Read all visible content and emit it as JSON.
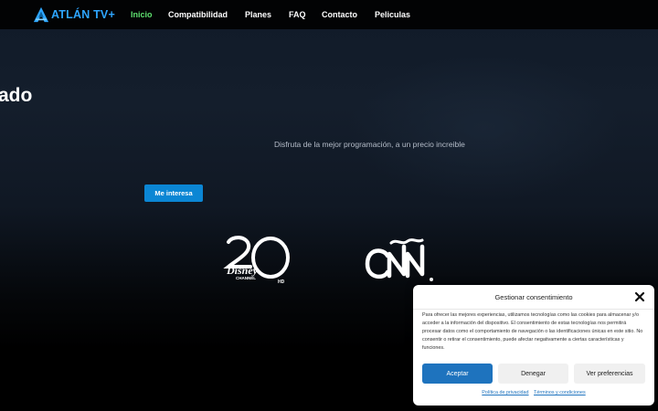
{
  "brand": {
    "name": "ATLÁN TV+",
    "accent_color": "#2ea6ff",
    "logo_icon": "atlan-a-logo"
  },
  "nav": {
    "items": [
      {
        "label": "Inicio",
        "active": true
      },
      {
        "label": "Compatibilidad",
        "active": false
      },
      {
        "label": "Planes",
        "active": false
      },
      {
        "label": "FAQ",
        "active": false
      },
      {
        "label": "Contacto",
        "active": false
      },
      {
        "label": "Peliculas",
        "active": false
      }
    ],
    "active_color": "#5ee06f"
  },
  "hero": {
    "heading_partial": "ado",
    "subtitle": "Disfruta de la mejor programación, a un precio increible",
    "cta_label": "Me interesa",
    "cta_color": "#0b86d4"
  },
  "channels": [
    {
      "name": "Disney Channel HD",
      "icon": "disney-channel-hd-logo",
      "text": "Disney",
      "subtext": "CHANNEL",
      "badge": "HD"
    },
    {
      "name": "CNN",
      "icon": "cnn-logo"
    }
  ],
  "consent": {
    "title": "Gestionar consentimiento",
    "body": "Para ofrecer las mejores experiencias, utilizamos tecnologías como las cookies para almacenar y/o acceder a la información del dispositivo. El consentimiento de estas tecnologías nos permitirá procesar datos como el comportamiento de navegación o las identificaciones únicas en este sitio. No consentir o retirar el consentimiento, puede afectar negativamente a ciertas características y funciones.",
    "accept_label": "Aceptar",
    "deny_label": "Denegar",
    "prefs_label": "Ver preferencias",
    "privacy_link": "Política de privacidad",
    "terms_link": "Términos y condiciones",
    "accept_color": "#1e73be"
  }
}
